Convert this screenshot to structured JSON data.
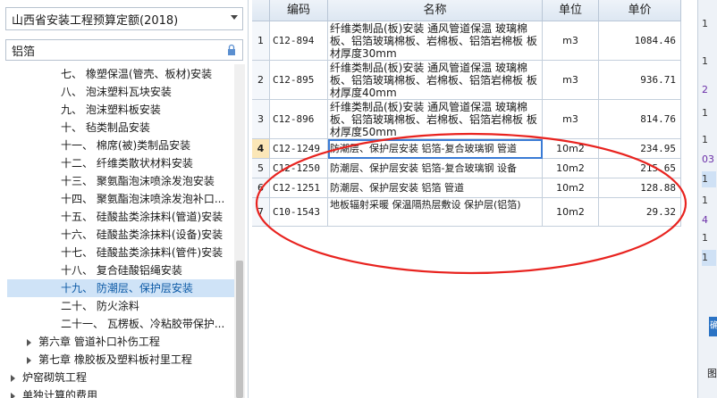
{
  "left_panel": {
    "quota_select": "山西省安装工程预算定额(2018)",
    "search_value": "铝箔",
    "tree": [
      {
        "label": "七、 橡塑保温(管壳、板材)安装",
        "indent": 3,
        "selected": false,
        "arrow": false
      },
      {
        "label": "八、 泡沫塑料瓦块安装",
        "indent": 3,
        "selected": false,
        "arrow": false
      },
      {
        "label": "九、 泡沫塑料板安装",
        "indent": 3,
        "selected": false,
        "arrow": false
      },
      {
        "label": "十、 毡类制品安装",
        "indent": 3,
        "selected": false,
        "arrow": false
      },
      {
        "label": "十一、 棉席(被)类制品安装",
        "indent": 3,
        "selected": false,
        "arrow": false
      },
      {
        "label": "十二、 纤维类散状材料安装",
        "indent": 3,
        "selected": false,
        "arrow": false
      },
      {
        "label": "十三、 聚氨酯泡沫喷涂发泡安装",
        "indent": 3,
        "selected": false,
        "arrow": false
      },
      {
        "label": "十四、 聚氨酯泡沫喷涂发泡补口...",
        "indent": 3,
        "selected": false,
        "arrow": false
      },
      {
        "label": "十五、 硅酸盐类涂抹料(管道)安装",
        "indent": 3,
        "selected": false,
        "arrow": false
      },
      {
        "label": "十六、 硅酸盐类涂抹料(设备)安装",
        "indent": 3,
        "selected": false,
        "arrow": false
      },
      {
        "label": "十七、 硅酸盐类涂抹料(管件)安装",
        "indent": 3,
        "selected": false,
        "arrow": false
      },
      {
        "label": "十八、 复合硅酸铝绳安装",
        "indent": 3,
        "selected": false,
        "arrow": false
      },
      {
        "label": "十九、 防潮层、保护层安装",
        "indent": 3,
        "selected": true,
        "arrow": false
      },
      {
        "label": "二十、 防火涂料",
        "indent": 3,
        "selected": false,
        "arrow": false
      },
      {
        "label": "二十一、 瓦楞板、冷粘胶带保护...",
        "indent": 3,
        "selected": false,
        "arrow": false
      },
      {
        "label": "第六章 管道补口补伤工程",
        "indent": 2,
        "selected": false,
        "arrow": true
      },
      {
        "label": "第七章 橡胶板及塑料板衬里工程",
        "indent": 2,
        "selected": false,
        "arrow": true
      },
      {
        "label": "炉窑砌筑工程",
        "indent": 1,
        "selected": false,
        "arrow": true
      },
      {
        "label": "单独计算的费用",
        "indent": 1,
        "selected": false,
        "arrow": true
      }
    ]
  },
  "table": {
    "headers": {
      "code": "编码",
      "name": "名称",
      "unit": "单位",
      "price": "单价"
    },
    "rows": [
      {
        "idx": "1",
        "code": "C12-894",
        "name": "纤维类制品(板)安装 通风管道保温 玻璃棉板、铝箔玻璃棉板、岩棉板、铝箔岩棉板 板材厚度30mm",
        "unit": "m3",
        "price": "1084.46"
      },
      {
        "idx": "2",
        "code": "C12-895",
        "name": "纤维类制品(板)安装 通风管道保温 玻璃棉板、铝箔玻璃棉板、岩棉板、铝箔岩棉板 板材厚度40mm",
        "unit": "m3",
        "price": "936.71"
      },
      {
        "idx": "3",
        "code": "C12-896",
        "name": "纤维类制品(板)安装 通风管道保温 玻璃棉板、铝箔玻璃棉板、岩棉板、铝箔岩棉板 板材厚度50mm",
        "unit": "m3",
        "price": "814.76"
      },
      {
        "idx": "4",
        "code": "C12-1249",
        "name": "防潮层、保护层安装 铝箔-复合玻璃钢 管道",
        "unit": "10m2",
        "price": "234.95"
      },
      {
        "idx": "5",
        "code": "C12-1250",
        "name": "防潮层、保护层安装 铝箔-复合玻璃钢 设备",
        "unit": "10m2",
        "price": "215.65"
      },
      {
        "idx": "6",
        "code": "C12-1251",
        "name": "防潮层、保护层安装 铝箔 管道",
        "unit": "10m2",
        "price": "128.88"
      },
      {
        "idx": "7",
        "code": "C10-1543",
        "name": "地板辐射采暖 保温隔热层敷设 保护层(铝箔)",
        "unit": "10m2",
        "price": "29.32"
      }
    ],
    "active_row": "4"
  },
  "right_strip": {
    "cells": [
      "1",
      "1",
      "2",
      "1",
      "1",
      "03",
      "1",
      "1",
      "4",
      "1",
      "1"
    ],
    "button_label": "确",
    "bottom_label": "图"
  },
  "colors": {
    "annotation_ellipse": "#e8231f",
    "selected_bg": "#cfe3f7",
    "selected_text": "#0c5aa6"
  }
}
